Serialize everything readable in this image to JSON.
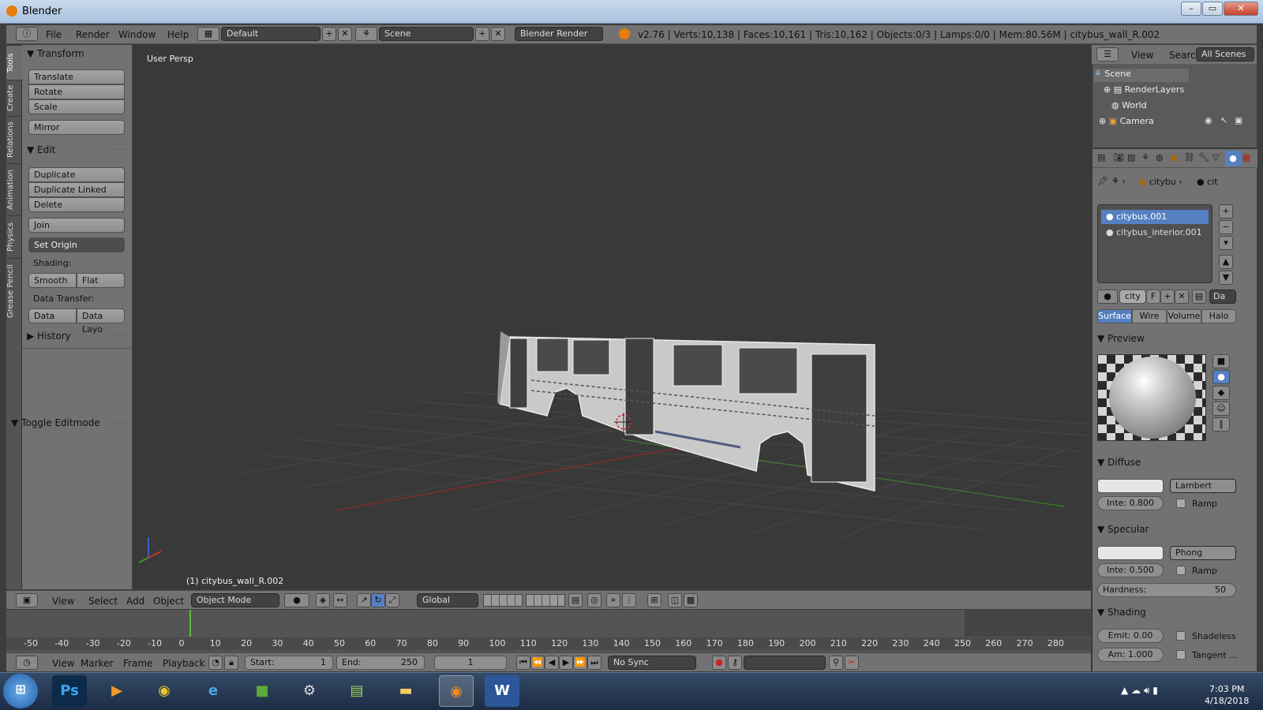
{
  "window": {
    "title": "Blender",
    "min": "–",
    "max": "▭",
    "close": "✕"
  },
  "top_menu": [
    "File",
    "Render",
    "Window",
    "Help"
  ],
  "layout_name": "Default",
  "scene_name": "Scene",
  "render_engine": "Blender Render",
  "stats": "v2.76 | Verts:10,138 | Faces:10,161 | Tris:10,162 | Objects:0/3 | Lamps:0/0 | Mem:80.56M | citybus_wall_R.002",
  "left_tabs": [
    "Tools",
    "Create",
    "Relations",
    "Animation",
    "Physics",
    "Grease Pencil"
  ],
  "tools": {
    "transform_header": "Transform",
    "translate": "Translate",
    "rotate": "Rotate",
    "scale": "Scale",
    "mirror": "Mirror",
    "edit_header": "Edit",
    "duplicate": "Duplicate",
    "duplicate_linked": "Duplicate Linked",
    "delete": "Delete",
    "join": "Join",
    "set_origin": "Set Origin",
    "shading_label": "Shading:",
    "smooth": "Smooth",
    "flat": "Flat",
    "data_transfer_label": "Data Transfer:",
    "data": "Data",
    "data_layo": "Data Layo",
    "history_header": "History",
    "toggle_editmode": "Toggle Editmode"
  },
  "viewport": {
    "label": "User Persp",
    "object": "(1) citybus_wall_R.002"
  },
  "view3d_header": {
    "menus": [
      "View",
      "Select",
      "Add",
      "Object"
    ],
    "mode": "Object Mode",
    "orientation": "Global"
  },
  "timeline": {
    "ticks": [
      "-50",
      "-40",
      "-30",
      "-20",
      "-10",
      "0",
      "10",
      "20",
      "30",
      "40",
      "50",
      "60",
      "70",
      "80",
      "90",
      "100",
      "110",
      "120",
      "130",
      "140",
      "150",
      "160",
      "170",
      "180",
      "190",
      "200",
      "210",
      "220",
      "230",
      "240",
      "250",
      "260",
      "270",
      "280"
    ],
    "menus": [
      "View",
      "Marker",
      "Frame",
      "Playback"
    ],
    "start": "Start:",
    "start_val": "1",
    "end": "End:",
    "end_val": "250",
    "current": "1",
    "sync": "No Sync"
  },
  "outliner": {
    "header": [
      "View",
      "Search",
      "All Scenes"
    ],
    "rows": [
      "Scene",
      "RenderLayers",
      "World",
      "Camera"
    ]
  },
  "properties": {
    "breadcrumb1": "citybu",
    "breadcrumb2": "cit",
    "materials": [
      "citybus.001",
      "citybus_interior.001"
    ],
    "mat_name": "city",
    "mat_f": "F",
    "mat_da": "Da",
    "tabs": [
      "Surface",
      "Wire",
      "Volume",
      "Halo"
    ],
    "preview": "Preview",
    "diffuse": "Diffuse",
    "diffuse_shader": "Lambert",
    "diffuse_inte": "Inte: 0.800",
    "ramp": "Ramp",
    "specular": "Specular",
    "specular_shader": "Phong",
    "specular_inte": "Inte: 0.500",
    "hardness": "Hardness:",
    "hardness_val": "50",
    "shading": "Shading",
    "emit": "Emit: 0.00",
    "shadeless": "Shadeless",
    "am": "Am: 1.000",
    "tangent": "Tangent ..."
  },
  "taskbar": {
    "time": "7:03 PM",
    "date": "4/18/2018",
    "ps": "Ps",
    "word": "W"
  }
}
